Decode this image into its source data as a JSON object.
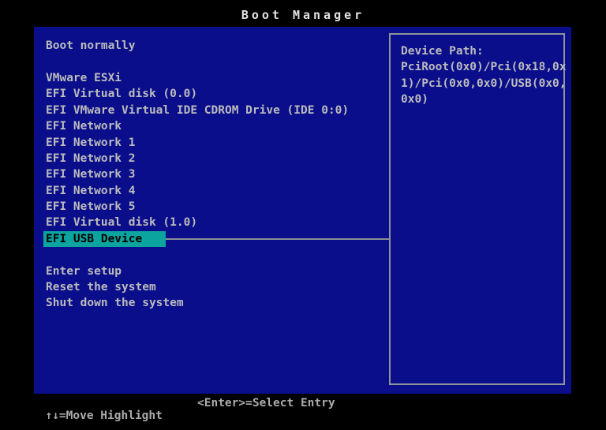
{
  "title": "Boot Manager",
  "colors": {
    "background": "#000000",
    "panel_blue": "#0a0e8a",
    "text_gray": "#bcbcbc",
    "title_white": "#e2e2e2",
    "highlight_teal": "#0ba49e",
    "highlight_text": "#000000",
    "border_gray": "#8e9498"
  },
  "menu": {
    "items": [
      {
        "label": "Boot normally",
        "highlighted": false
      },
      {
        "label": "",
        "highlighted": false
      },
      {
        "label": "VMware ESXi",
        "highlighted": false
      },
      {
        "label": "EFI Virtual disk (0.0)",
        "highlighted": false
      },
      {
        "label": "EFI VMware Virtual IDE CDROM Drive (IDE 0:0)",
        "highlighted": false
      },
      {
        "label": "EFI Network",
        "highlighted": false
      },
      {
        "label": "EFI Network 1",
        "highlighted": false
      },
      {
        "label": "EFI Network 2",
        "highlighted": false
      },
      {
        "label": "EFI Network 3",
        "highlighted": false
      },
      {
        "label": "EFI Network 4",
        "highlighted": false
      },
      {
        "label": "EFI Network 5",
        "highlighted": false
      },
      {
        "label": "EFI Virtual disk (1.0)",
        "highlighted": false
      },
      {
        "label": "EFI USB Device",
        "highlighted": true
      },
      {
        "label": "",
        "highlighted": false
      },
      {
        "label": "Enter setup",
        "highlighted": false
      },
      {
        "label": "Reset the system",
        "highlighted": false
      },
      {
        "label": "Shut down the system",
        "highlighted": false
      }
    ]
  },
  "device_path": {
    "heading": "Device Path:",
    "lines": [
      "PciRoot(0x0)/Pci(0x18,0x",
      "1)/Pci(0x0,0x0)/USB(0x0,",
      "0x0)"
    ],
    "full_path": "PciRoot(0x0)/Pci(0x18,0x1)/Pci(0x0,0x0)/USB(0x0,0x0)"
  },
  "help": {
    "move": "↑↓=Move Highlight",
    "select": "<Enter>=Select Entry"
  }
}
